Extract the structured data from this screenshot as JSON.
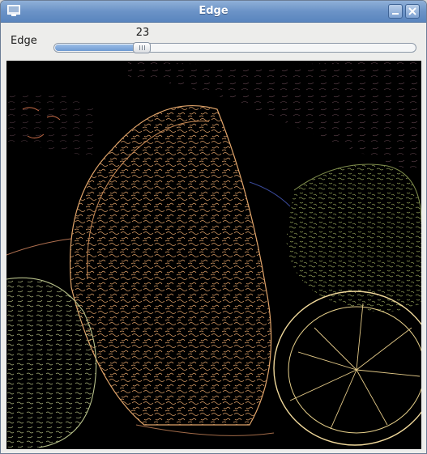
{
  "window": {
    "title": "Edge"
  },
  "controls": {
    "edge_label": "Edge",
    "threshold_value": "23",
    "threshold_fraction": 0.23
  },
  "image": {
    "description_icon": "edge-detection-image"
  },
  "colors": {
    "titlebar": "#6b93c7",
    "window_bg": "#ededeb",
    "slider_fill": "#6f9bd2",
    "canvas_bg": "#000000"
  }
}
